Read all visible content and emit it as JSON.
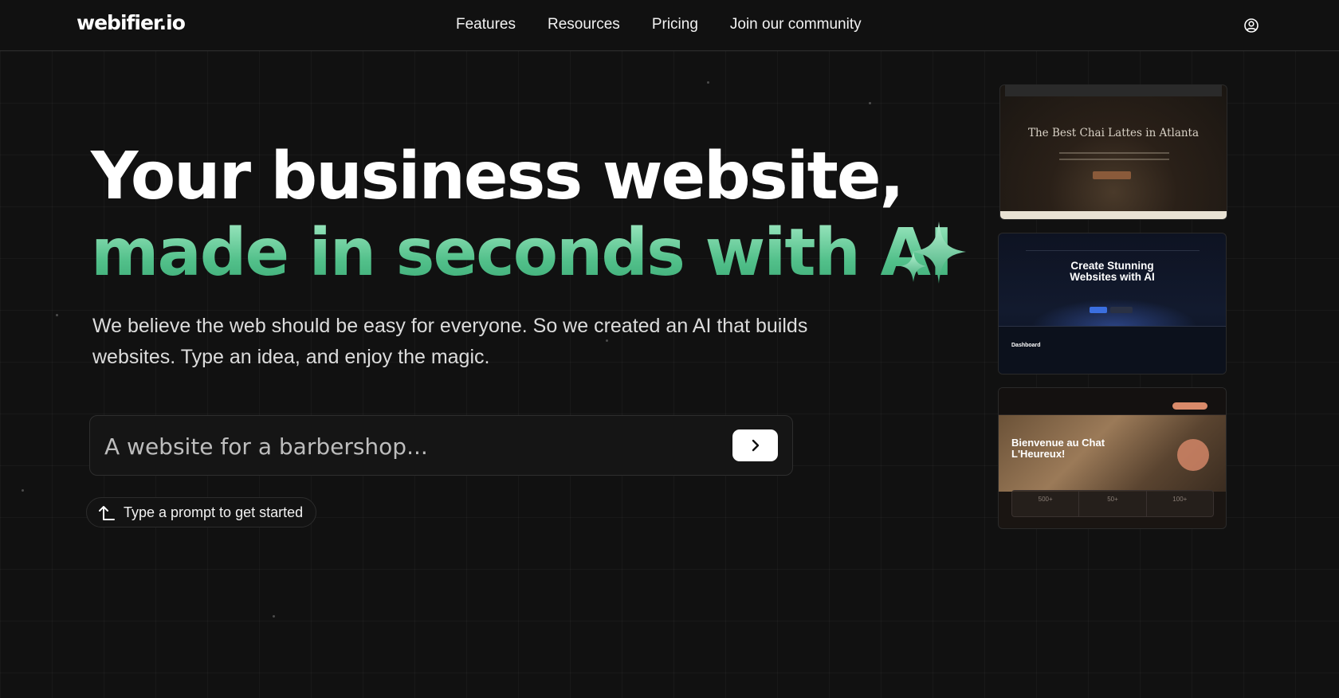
{
  "header": {
    "logo": "webifier.io",
    "nav": [
      "Features",
      "Resources",
      "Pricing",
      "Join our community"
    ],
    "account_icon": "user-circle-icon"
  },
  "hero": {
    "headline_line1": "Your business website,",
    "headline_line2": "made in seconds with AI",
    "headline_icon": "sparkles-icon",
    "subtitle": "We believe the web should be easy for everyone. So we created an AI that builds websites. Type an idea, and enjoy the magic.",
    "prompt_placeholder": "A website for a barbershop...",
    "submit_icon": "chevron-right-icon",
    "hint": "Type a prompt to get started",
    "hint_icon": "arrow-up-left-icon"
  },
  "previews": {
    "card1_title": "The Best Chai Lattes in Atlanta",
    "card2_title_line1": "Create Stunning",
    "card2_title_line2": "Websites with AI",
    "card2_dashboard": "Dashboard",
    "card3_title": "Bienvenue au Chat L'Heureux!",
    "card3_stats": [
      "500+",
      "50+",
      "100+"
    ]
  },
  "colors": {
    "background": "#111111",
    "accent_green": "#52c08a",
    "text": "#ffffff"
  }
}
